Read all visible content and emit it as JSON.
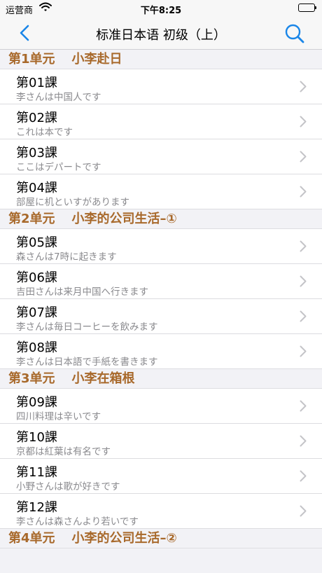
{
  "status_bar": {
    "carrier": "运营商",
    "time": "下午8:25",
    "wifi_icon": "wifi-icon",
    "battery_icon": "battery-icon"
  },
  "nav": {
    "title": "标准日本语 初级（上）",
    "back_icon": "chevron-left-icon",
    "search_icon": "search-icon",
    "accent_color": "#1a86e8"
  },
  "header_color": "#a8692b",
  "sections": [
    {
      "unit": "第1单元",
      "name": "小李赴日",
      "lessons": [
        {
          "title": "第01課",
          "subtitle": "李さんは中国人です"
        },
        {
          "title": "第02課",
          "subtitle": "これは本です"
        },
        {
          "title": "第03課",
          "subtitle": "ここはデパートです"
        },
        {
          "title": "第04課",
          "subtitle": "部屋に机といすがあります"
        }
      ]
    },
    {
      "unit": "第2单元",
      "name": "小李的公司生活–①",
      "lessons": [
        {
          "title": "第05課",
          "subtitle": "森さんは7時に起きます"
        },
        {
          "title": "第06課",
          "subtitle": "吉田さんは来月中国へ行きます"
        },
        {
          "title": "第07課",
          "subtitle": "李さんは毎日コーヒーを飲みます"
        },
        {
          "title": "第08課",
          "subtitle": "李さんは日本語で手紙を書きます"
        }
      ]
    },
    {
      "unit": "第3单元",
      "name": "小李在箱根",
      "lessons": [
        {
          "title": "第09課",
          "subtitle": "四川料理は辛いです"
        },
        {
          "title": "第10課",
          "subtitle": "京都は紅葉は有名です"
        },
        {
          "title": "第11課",
          "subtitle": "小野さんは歌が好きです"
        },
        {
          "title": "第12課",
          "subtitle": "李さんは森さんより若いです"
        }
      ]
    },
    {
      "unit": "第4单元",
      "name": "小李的公司生活–②",
      "lessons": []
    }
  ]
}
